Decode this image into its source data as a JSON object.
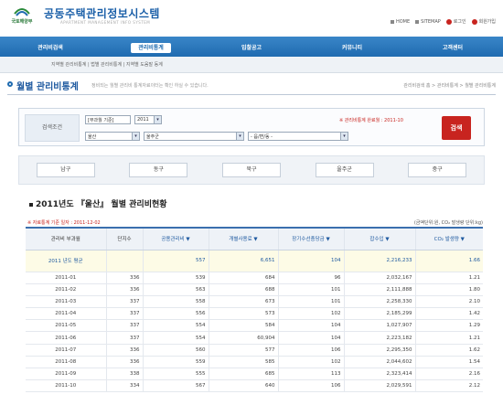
{
  "header": {
    "logo_text": "국토해양부",
    "site_title": "공동주택관리정보시스템",
    "site_subtitle": "APARTMENT MANAGEMENT INFO SYSTEM",
    "util": [
      "HOME",
      "SITEMAP",
      "로그인",
      "회원가입"
    ]
  },
  "gnb": {
    "items": [
      "관리비검색",
      "관리비통계",
      "입찰공고",
      "커뮤니티",
      "고객센터"
    ],
    "active_index": 1
  },
  "subnav": {
    "text": "지역별 관리비통계 | 법별 관리비통계 | 지역별 도움말 동계"
  },
  "page": {
    "title": "월별 관리비통계",
    "description": "정비되는 월별 관리비 통계자료이터는 확인 하실 수 있습니다.",
    "breadcrumb": "관리비검색 홈 > 관리비통계 > 월별 관리비통계"
  },
  "search": {
    "label": "검색조건",
    "period_label": "[부과월 기준]",
    "year": "2011",
    "city": "울산",
    "district": "울주군",
    "dong": "- 읍/면/동 -",
    "note": "※ 관리비통계 완료월 : 2011-10",
    "button": "검색"
  },
  "districts": [
    "남구",
    "동구",
    "북구",
    "울주군",
    "중구"
  ],
  "section": {
    "title": "2011년도 『울산』 월별 관리비현황",
    "sub_note": "※ 자료통계 기준 일자 : 2011-12-02",
    "unit_note": "(금액단위:원, CO₂ 발생량 단위:kg)"
  },
  "table": {
    "headers": [
      "관리비 부과월",
      "단지수",
      "공용관리비 ▼",
      "개별사용료 ▼",
      "장기수선충당금 ▼",
      "잡수입 ▼",
      "CO₂ 발생량 ▼"
    ],
    "average": [
      "2011 년도 평균",
      "",
      "557",
      "6,651",
      "104",
      "2,216,233",
      "1.66"
    ],
    "rows": [
      [
        "2011-01",
        "336",
        "539",
        "684",
        "96",
        "2,032,167",
        "1.21"
      ],
      [
        "2011-02",
        "336",
        "563",
        "688",
        "101",
        "2,111,888",
        "1.80"
      ],
      [
        "2011-03",
        "337",
        "558",
        "673",
        "101",
        "2,258,330",
        "2.10"
      ],
      [
        "2011-04",
        "337",
        "556",
        "573",
        "102",
        "2,185,299",
        "1.42"
      ],
      [
        "2011-05",
        "337",
        "554",
        "584",
        "104",
        "1,027,907",
        "1.29"
      ],
      [
        "2011-06",
        "337",
        "554",
        "60,904",
        "104",
        "2,223,182",
        "1.21"
      ],
      [
        "2011-07",
        "336",
        "560",
        "577",
        "106",
        "2,295,350",
        "1.62"
      ],
      [
        "2011-08",
        "336",
        "559",
        "585",
        "102",
        "2,044,602",
        "1.54"
      ],
      [
        "2011-09",
        "338",
        "555",
        "685",
        "113",
        "2,323,414",
        "2.16"
      ],
      [
        "2011-10",
        "334",
        "567",
        "640",
        "106",
        "2,029,591",
        "2.12"
      ]
    ]
  },
  "colors": {
    "brand": "#1f6bb0",
    "accent": "#c8241f"
  }
}
